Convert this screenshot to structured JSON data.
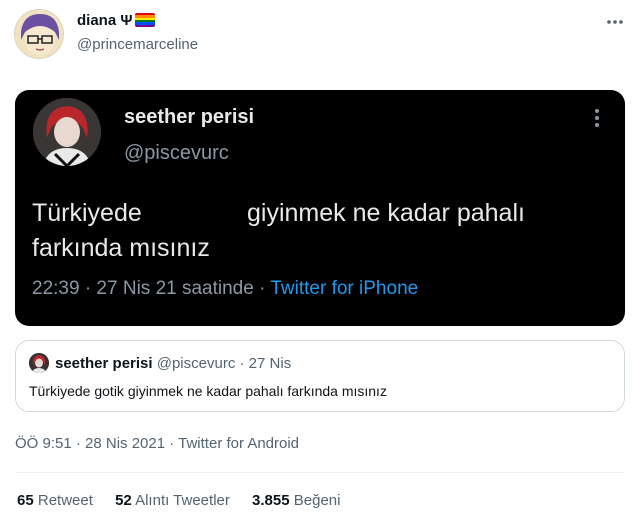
{
  "author": {
    "name": "diana Ψ",
    "handle": "@princemarceline"
  },
  "screenshot": {
    "name": "seether perisi",
    "handle": "@piscevurc",
    "text_word1": "Türkiyede",
    "text_rest": "giyinmek ne kadar pahalı farkında mısınız",
    "meta_time": "22:39 · 27 Nis 21 saatinde · ",
    "meta_source": "Twitter for iPhone"
  },
  "quote": {
    "name": "seether perisi",
    "handle": "@piscevurc",
    "separator": "·",
    "date": "27 Nis",
    "text": "Türkiyede gotik giyinmek ne kadar pahalı farkında mısınız"
  },
  "meta": "ÖÖ 9:51 · 28 Nis 2021 · Twitter for Android",
  "stats": {
    "retweets_count": "65",
    "retweets_label": "Retweet",
    "quotes_count": "52",
    "quotes_label": "Alıntı Tweetler",
    "likes_count": "3.855",
    "likes_label": "Beğeni"
  },
  "colors": {
    "flag": [
      "#e40303",
      "#ff8c00",
      "#ffed00",
      "#008026",
      "#004dff",
      "#750787"
    ],
    "link": "#1d9bf0"
  }
}
